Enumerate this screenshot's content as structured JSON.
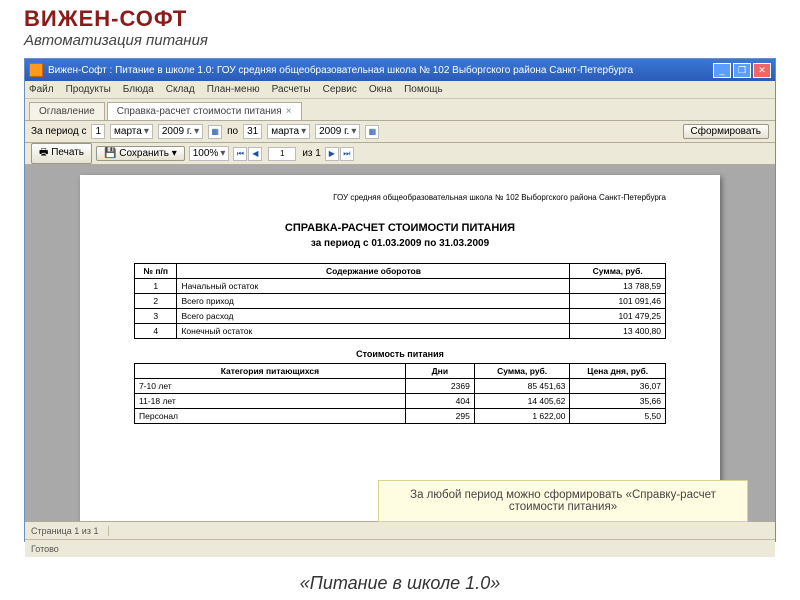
{
  "brand": {
    "title": "ВИЖЕН-СОФТ",
    "subtitle": "Автоматизация питания"
  },
  "window": {
    "title": "Вижен-Софт : Питание в школе 1.0: ГОУ средняя общеобразовательная школа № 102 Выборгского района Санкт-Петербурга"
  },
  "menu": [
    "Файл",
    "Продукты",
    "Блюда",
    "Склад",
    "План-меню",
    "Расчеты",
    "Сервис",
    "Окна",
    "Помощь"
  ],
  "tabs": [
    {
      "label": "Оглавление"
    },
    {
      "label": "Справка-расчет стоимости питания"
    }
  ],
  "datebar": {
    "label": "За период с",
    "d1": "1",
    "m1": "марта",
    "y1": "2009 г.",
    "to": "по",
    "d2": "31",
    "m2": "марта",
    "y2": "2009 г.",
    "btn": "Сформировать"
  },
  "toolbar": {
    "print": "Печать",
    "save": "Сохранить",
    "zoom": "100%",
    "page": "1",
    "total": "из 1"
  },
  "report": {
    "org": "ГОУ средняя общеобразовательная школа № 102 Выборгского района Санкт-Петербурга",
    "title": "СПРАВКА-РАСЧЕТ СТОИМОСТИ ПИТАНИЯ",
    "period": "за период с 01.03.2009 по 31.03.2009",
    "t1head": {
      "n": "№ п/п",
      "desc": "Содержание оборотов",
      "sum": "Сумма, руб."
    },
    "t1": [
      {
        "n": "1",
        "desc": "Начальный остаток",
        "sum": "13 788,59"
      },
      {
        "n": "2",
        "desc": "Всего приход",
        "sum": "101 091,46"
      },
      {
        "n": "3",
        "desc": "Всего расход",
        "sum": "101 479,25"
      },
      {
        "n": "4",
        "desc": "Конечный остаток",
        "sum": "13 400,80"
      }
    ],
    "t2cap": "Стоимость питания",
    "t2head": {
      "cat": "Категория питающихся",
      "days": "Дни",
      "sum": "Сумма, руб.",
      "price": "Цена дня, руб."
    },
    "t2": [
      {
        "cat": "7-10 лет",
        "days": "2369",
        "sum": "85 451,63",
        "price": "36,07"
      },
      {
        "cat": "11-18 лет",
        "days": "404",
        "sum": "14 405,62",
        "price": "35,66"
      },
      {
        "cat": "Персонал",
        "days": "295",
        "sum": "1 622,00",
        "price": "5,50"
      }
    ]
  },
  "callout": "За любой период можно сформировать «Справку-расчет стоимости питания»",
  "status": {
    "page": "Страница 1 из 1",
    "ready": "Готово"
  },
  "footer": "«Питание в школе 1.0»"
}
